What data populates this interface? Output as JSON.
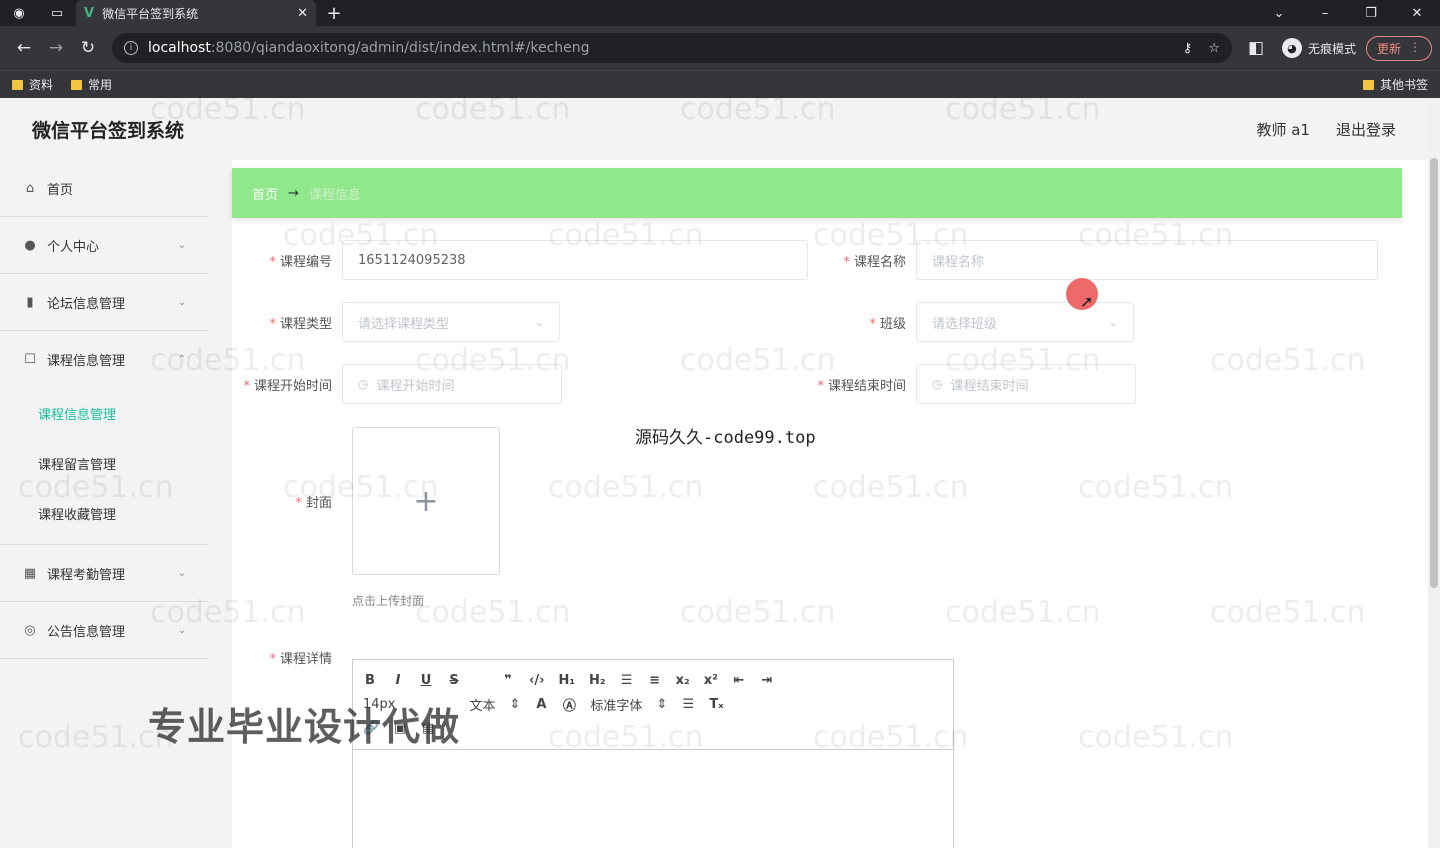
{
  "browser": {
    "tab_title": "微信平台签到系统",
    "url_host": "localhost",
    "url_path": ":8080/qiandaoxitong/admin/dist/index.html#/kecheng",
    "incognito_label": "无痕模式",
    "update_label": "更新",
    "bookmarks": [
      "资料",
      "常用"
    ],
    "other_bookmarks": "其他书签"
  },
  "app": {
    "title": "微信平台签到系统",
    "user_label": "教师 a1",
    "logout_label": "退出登录"
  },
  "sidebar": {
    "items": [
      {
        "label": "首页",
        "icon": "home-icon"
      },
      {
        "label": "个人中心",
        "icon": "user-icon"
      },
      {
        "label": "论坛信息管理",
        "icon": "chart-icon"
      },
      {
        "label": "课程信息管理",
        "icon": "square-icon"
      },
      {
        "label": "课程考勤管理",
        "icon": "grid-icon"
      },
      {
        "label": "公告信息管理",
        "icon": "globe-icon"
      }
    ],
    "sub_items": [
      "课程信息管理",
      "课程留言管理",
      "课程收藏管理"
    ]
  },
  "breadcrumb": {
    "home": "首页",
    "arrow": "→",
    "current": "课程信息"
  },
  "form": {
    "course_no_label": "课程编号",
    "course_no_value": "1651124095238",
    "course_name_label": "课程名称",
    "course_name_placeholder": "课程名称",
    "course_type_label": "课程类型",
    "course_type_placeholder": "请选择课程类型",
    "class_label": "班级",
    "class_placeholder": "请选择班级",
    "start_time_label": "课程开始时间",
    "start_time_placeholder": "课程开始时间",
    "end_time_label": "课程结束时间",
    "end_time_placeholder": "课程结束时间",
    "cover_label": "封面",
    "upload_tip": "点击上传封面",
    "detail_label": "课程详情"
  },
  "editor": {
    "font_size": "14px",
    "text_type": "文本",
    "font_family": "标准字体"
  },
  "overlays": {
    "watermark": "code51.cn",
    "center_text": "源码久久-code99.top",
    "promo_text": "专业毕业设计代做"
  }
}
